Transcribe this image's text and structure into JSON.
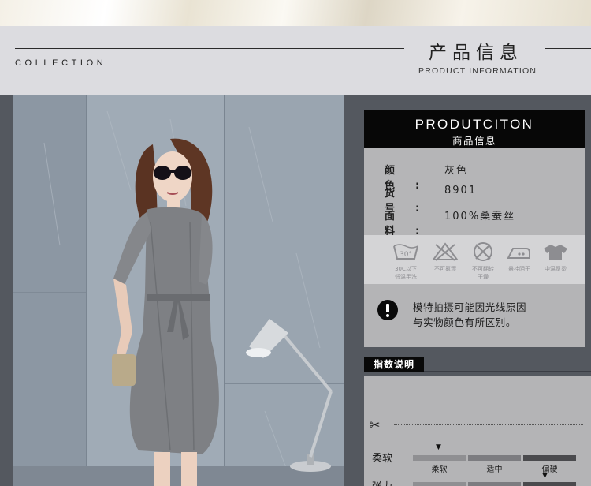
{
  "header": {
    "collection": "COLLECTION",
    "title_zh": "产品信息",
    "title_en": "PRODUCT INFORMATION"
  },
  "product": {
    "heading_en": "PRODUTCITON",
    "heading_zh": "商品信息",
    "rows": [
      {
        "key": "颜色:",
        "value": "灰色"
      },
      {
        "key": "货号:",
        "value": "8901"
      },
      {
        "key": "面料:",
        "value": "100%桑蚕丝"
      }
    ]
  },
  "care": [
    {
      "icon": "wash-30-icon",
      "label_line1": "30C以下",
      "label_line2": "低温手洗"
    },
    {
      "icon": "no-bleach-icon",
      "label_line1": "不可氯漂",
      "label_line2": ""
    },
    {
      "icon": "no-tumble-dry-icon",
      "label_line1": "不可翻转",
      "label_line2": "干燥"
    },
    {
      "icon": "iron-icon",
      "label_line1": "悬挂阴干",
      "label_line2": ""
    },
    {
      "icon": "shirt-icon",
      "label_line1": "中温熨烫",
      "label_line2": ""
    }
  ],
  "notice": {
    "line1": "模特拍摄可能因光线原因",
    "line2": "与实物颜色有所区别。"
  },
  "index": {
    "tag": "指数说明",
    "metrics": [
      {
        "label": "柔软",
        "levels": [
          "柔软",
          "适中",
          "偏硬"
        ],
        "selected": 0
      },
      {
        "label": "弹力",
        "levels": [],
        "selected": 2
      }
    ]
  },
  "colors": {
    "black": "#070707",
    "panel_gray": "#b5b5b7",
    "header_bg": "#dcdce0",
    "page_bg": "#54585f"
  }
}
